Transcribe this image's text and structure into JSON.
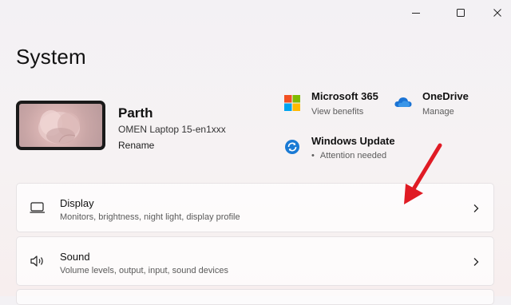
{
  "page": {
    "title": "System"
  },
  "device": {
    "name": "Parth",
    "model": "OMEN Laptop 15-en1xxx",
    "rename_label": "Rename"
  },
  "tiles": {
    "microsoft365": {
      "title": "Microsoft 365",
      "subtitle": "View benefits",
      "icon": "microsoft-logo-icon"
    },
    "onedrive": {
      "title": "OneDrive",
      "subtitle": "Manage",
      "icon": "cloud-icon"
    },
    "windows_update": {
      "title": "Windows Update",
      "subtitle": "Attention needed",
      "icon": "sync-icon",
      "status_dot": "•"
    }
  },
  "settings": [
    {
      "title": "Display",
      "subtitle": "Monitors, brightness, night light, display profile",
      "icon": "monitor-icon"
    },
    {
      "title": "Sound",
      "subtitle": "Volume levels, output, input, sound devices",
      "icon": "speaker-icon"
    }
  ],
  "annotation": {
    "color": "#e01b24",
    "icon": "red-arrow-icon"
  },
  "colors": {
    "accent": "#0067c0",
    "onedrive": "#1a73d4",
    "ms_red": "#f25022",
    "ms_green": "#7fba00",
    "ms_blue": "#00a4ef",
    "ms_yellow": "#ffb900"
  }
}
